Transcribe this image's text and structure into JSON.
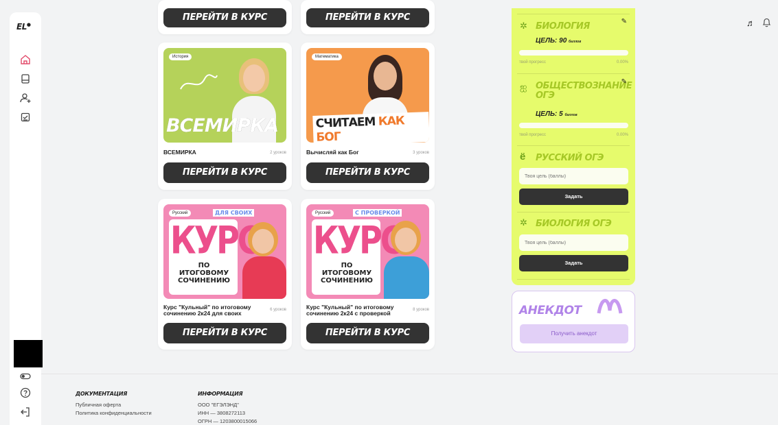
{
  "sidebar": {
    "logo": "EL",
    "logo_mark": "●"
  },
  "course_button_label": "ПЕРЕЙТИ В КУРС",
  "courses": [
    {
      "tag": "История",
      "banner": "ВСЕМИРКА",
      "title": "ВСЕМИРКА",
      "lessons": "2 уроков"
    },
    {
      "tag": "Математика",
      "banner_a": "СЧИТАЕМ",
      "banner_b": "КАК БОГ",
      "title": "Вычисляй как Бог",
      "lessons": "3 уроков"
    },
    {
      "tag": "Русский",
      "ribbon": "ДЛЯ СВОИХ",
      "banner_big": "КУРС",
      "banner_small": "ПО ИТОГОВОМУ СОЧИНЕНИЮ",
      "title": "Курс \"Кульный\" по итоговому сочинению 2к24 для своих",
      "lessons": "6 уроков"
    },
    {
      "tag": "Русский",
      "ribbon": "С ПРОВЕРКОЙ",
      "banner_big": "КУРС",
      "banner_small": "ПО ИТОГОВОМУ СОЧИНЕНИЮ",
      "title": "Курс \"Кульный\" по итоговому сочинению 2к24 с проверкой",
      "lessons": "8 уроков"
    }
  ],
  "goals": {
    "biology": {
      "name": "БИОЛОГИЯ",
      "target": "ЦЕЛЬ: 90",
      "target_unit": "баллов",
      "progress_label": "твой прогресс",
      "progress_value": "0.00%"
    },
    "social": {
      "name": "ОБЩЕСТВОЗНАНИЕ ОГЭ",
      "target": "ЦЕЛЬ: 5",
      "target_unit": "баллов",
      "progress_label": "твой прогресс",
      "progress_value": "0.00%"
    },
    "russian": {
      "name": "РУССКИЙ ОГЭ",
      "placeholder": "Твоя цель (баллы)",
      "button": "Задать"
    },
    "biology_oge": {
      "name": "БИОЛОГИЯ ОГЭ",
      "placeholder": "Твоя цель (баллы)",
      "button": "Задать"
    }
  },
  "joke": {
    "title": "АНЕКДОТ",
    "button": "Получить анекдот"
  },
  "footer": {
    "docs_heading": "ДОКУМЕНТАЦИЯ",
    "docs": [
      "Публичная оферта",
      "Политика конфиденциальности"
    ],
    "info_heading": "ИНФОРМАЦИЯ",
    "info": [
      "ООО \"ЕГЭЛЭНД\"",
      "ИНН — 3808272113",
      "ОГРН — 1203800015066"
    ]
  },
  "colors": {
    "accent_lime": "#e6fb6c",
    "dark_button": "#333333",
    "history_bg": "#b5d25a",
    "math_bg": "#f59a4c",
    "russian_bg": "#f38ab6",
    "joke_purple": "#b083e8"
  }
}
